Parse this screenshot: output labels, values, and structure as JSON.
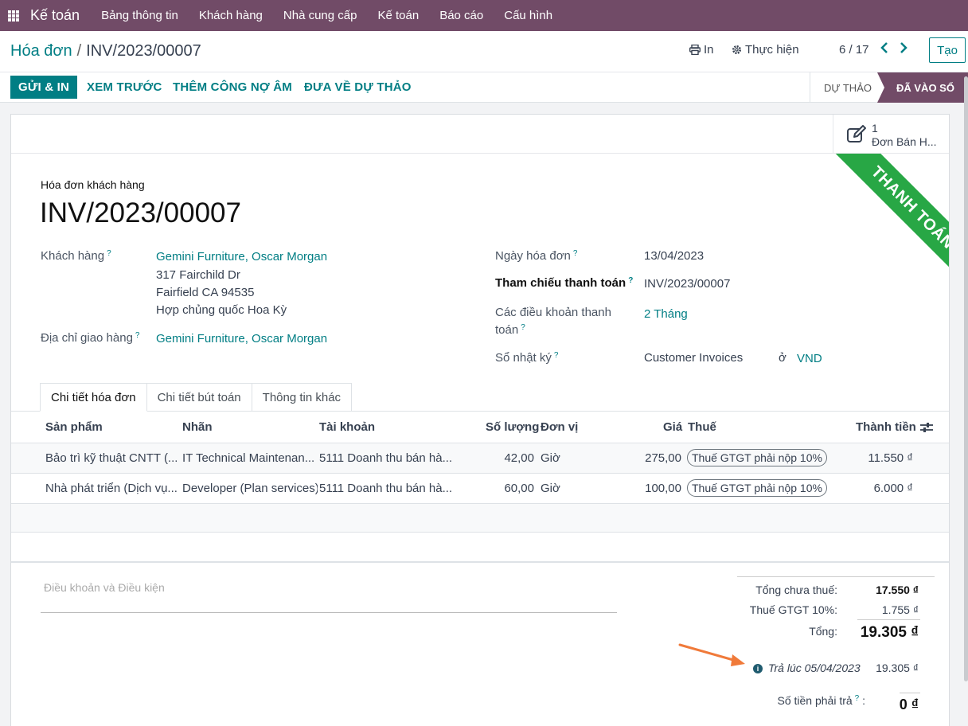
{
  "nav": {
    "app_name": "Kế toán",
    "menu": [
      "Bảng thông tin",
      "Khách hàng",
      "Nhà cung cấp",
      "Kế toán",
      "Báo cáo",
      "Cấu hình"
    ]
  },
  "control": {
    "breadcrumb_parent": "Hóa đơn",
    "breadcrumb_separator": "/",
    "breadcrumb_current": "INV/2023/00007",
    "print_label": "In",
    "action_label": "Thực hiện",
    "pager": "6 / 17",
    "create_label": "Tạo"
  },
  "status_bar": {
    "buttons": [
      "GỬI & IN",
      "XEM TRƯỚC",
      "THÊM CÔNG NỢ ÂM",
      "ĐƯA VỀ DỰ THẢO"
    ],
    "stages": [
      "DỰ THẢO",
      "ĐÃ VÀO SỔ"
    ]
  },
  "smart_button": {
    "count": "1",
    "label": "Đơn Bán H..."
  },
  "ribbon": "THANH TOÁN",
  "document": {
    "type": "Hóa đơn khách hàng",
    "name": "INV/2023/00007"
  },
  "fields_left": {
    "customer_label": "Khách hàng",
    "customer": "Gemini Furniture, Oscar Morgan",
    "address": [
      "317 Fairchild Dr",
      "Fairfield CA 94535",
      "Hợp chủng quốc Hoa Kỳ"
    ],
    "delivery_label": "Địa chỉ giao hàng",
    "delivery": "Gemini Furniture, Oscar Morgan"
  },
  "fields_right": {
    "invoice_date_label": "Ngày hóa đơn",
    "invoice_date": "13/04/2023",
    "payment_ref_label": "Tham chiếu thanh toán",
    "payment_ref": "INV/2023/00007",
    "payment_terms_label_1": "Các điều khoản thanh",
    "payment_terms_label_2": "toán",
    "payment_terms": "2 Tháng",
    "journal_label": "Sổ nhật ký",
    "journal": "Customer Invoices",
    "currency_prefix": "ở",
    "currency": "VND"
  },
  "help_mark": "?",
  "tabs": [
    "Chi tiết hóa đơn",
    "Chi tiết bút toán",
    "Thông tin khác"
  ],
  "table": {
    "headers": {
      "product": "Sản phẩm",
      "label": "Nhãn",
      "account": "Tài khoản",
      "quantity": "Số lượng",
      "uom": "Đơn vị",
      "price": "Giá",
      "tax": "Thuế",
      "subtotal": "Thành tiền"
    },
    "rows": [
      {
        "product": "Bảo trì kỹ thuật CNTT (...",
        "label": "IT Technical Maintenan...",
        "account": "5111 Doanh thu bán hà...",
        "quantity": "42,00",
        "uom": "Giờ",
        "price": "275,00",
        "tax": "Thuế GTGT phải nộp 10%",
        "subtotal": "11.550 ₫"
      },
      {
        "product": "Nhà phát triển (Dịch vụ...",
        "label": "Developer (Plan services)",
        "account": "5111 Doanh thu bán hà...",
        "quantity": "60,00",
        "uom": "Giờ",
        "price": "100,00",
        "tax": "Thuế GTGT phải nộp 10%",
        "subtotal": "6.000 ₫"
      }
    ]
  },
  "terms_placeholder": "Điều khoản và Điều kiện",
  "totals": {
    "untaxed_label": "Tổng chưa thuế:",
    "untaxed": "17.550 ₫",
    "tax_label": "Thuế GTGT 10%:",
    "tax": "1.755 ₫",
    "total_label": "Tổng:",
    "total": "19.305 ₫",
    "paid_label": "Trả lúc 05/04/2023",
    "paid": "19.305 ₫",
    "due_label": "Số tiền phải trả",
    "due": "0 ₫"
  }
}
